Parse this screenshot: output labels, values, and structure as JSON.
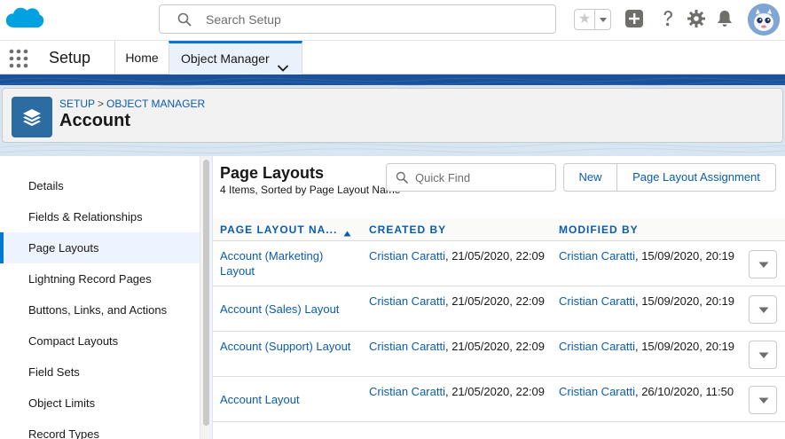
{
  "header": {
    "search_placeholder": "Search Setup"
  },
  "app_nav": {
    "app_name": "Setup",
    "tabs": [
      {
        "label": "Home"
      },
      {
        "label": "Object Manager"
      }
    ]
  },
  "page_header": {
    "breadcrumb": [
      "SETUP",
      "OBJECT MANAGER"
    ],
    "separator": ">",
    "title": "Account"
  },
  "sidebar": {
    "items": [
      {
        "label": "Details"
      },
      {
        "label": "Fields & Relationships"
      },
      {
        "label": "Page Layouts"
      },
      {
        "label": "Lightning Record Pages"
      },
      {
        "label": "Buttons, Links, and Actions"
      },
      {
        "label": "Compact Layouts"
      },
      {
        "label": "Field Sets"
      },
      {
        "label": "Object Limits"
      },
      {
        "label": "Record Types"
      }
    ],
    "active": "Page Layouts"
  },
  "main": {
    "title": "Page Layouts",
    "subtitle": "4 Items, Sorted by Page Layout Name",
    "quick_find_placeholder": "Quick Find",
    "new_button": "New",
    "assignment_button": "Page Layout Assignment",
    "columns": [
      "PAGE LAYOUT NA...",
      "CREATED BY",
      "MODIFIED BY"
    ],
    "rows": [
      {
        "name": "Account (Marketing) Layout",
        "created_by": "Cristian Caratti",
        "created_at": ", 21/05/2020, 22:09",
        "modified_by": "Cristian Caratti",
        "modified_at": ", 15/09/2020, 20:19"
      },
      {
        "name": "Account (Sales) Layout",
        "created_by": "Cristian Caratti",
        "created_at": ", 21/05/2020, 22:09",
        "modified_by": "Cristian Caratti",
        "modified_at": ", 15/09/2020, 20:19"
      },
      {
        "name": "Account (Support) Layout",
        "created_by": "Cristian Caratti",
        "created_at": ", 21/05/2020, 22:09",
        "modified_by": "Cristian Caratti",
        "modified_at": ", 15/09/2020, 20:19"
      },
      {
        "name": "Account Layout",
        "created_by": "Cristian Caratti",
        "created_at": ", 21/05/2020, 22:09",
        "modified_by": "Cristian Caratti",
        "modified_at": ", 26/10/2020, 11:50"
      }
    ]
  },
  "icons": {
    "logo": "salesforce-cloud-icon",
    "search": "search-icon",
    "favorites": "star-icon",
    "global_actions": "plus-icon",
    "help": "question-icon",
    "setup": "gear-icon",
    "notifications": "bell-icon",
    "app_launcher": "waffle-icon",
    "object": "layers-icon"
  },
  "colors": {
    "brand_blue": "#0176d3",
    "link_blue": "#0b5cab",
    "cloud_blue": "#00a1e0",
    "band_dark": "#1b5297",
    "object_icon": "#2d6ca2"
  }
}
